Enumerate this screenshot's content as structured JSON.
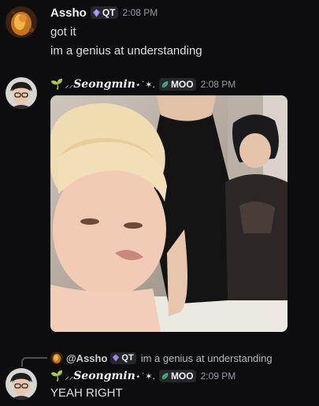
{
  "messages": [
    {
      "username": "Assho",
      "tag": "QT",
      "timestamp": "2:08 PM",
      "lines": [
        "got it",
        "im a genius at understanding"
      ]
    },
    {
      "username_prefix": "⸝⸝ ",
      "username": "Seongmin",
      "username_suffix": " ⋆˙✶.",
      "tag": "MOO",
      "timestamp": "2:08 PM",
      "attachment": "video"
    },
    {
      "reply": {
        "mention": "@Assho",
        "tag": "QT",
        "text": "im a genius at understanding"
      },
      "username_prefix": "⸝⸝ ",
      "username": "Seongmin",
      "username_suffix": " ⋆˙✶.",
      "tag": "MOO",
      "timestamp": "2:09 PM",
      "lines": [
        "YEAH RIGHT"
      ]
    }
  ],
  "colors": {
    "background": "#0d0d0f",
    "tag_background": "#26272d",
    "qt_icon": "#9b84ec",
    "moo_icon": "#43b581",
    "timestamp": "#949ba4"
  },
  "icons": {
    "qt_tag": "purple-gem-icon",
    "moo_tag": "leaf-icon",
    "name_decoration": "sprout-icon"
  }
}
